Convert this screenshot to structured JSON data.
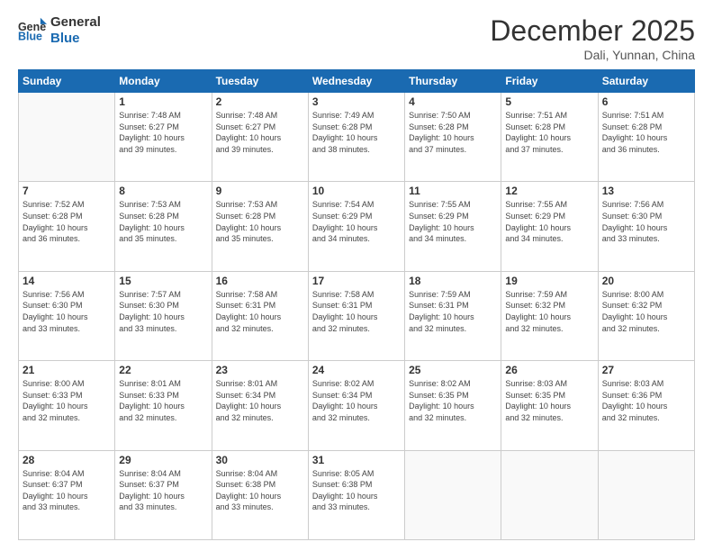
{
  "header": {
    "logo_line1": "General",
    "logo_line2": "Blue",
    "month_title": "December 2025",
    "location": "Dali, Yunnan, China"
  },
  "weekdays": [
    "Sunday",
    "Monday",
    "Tuesday",
    "Wednesday",
    "Thursday",
    "Friday",
    "Saturday"
  ],
  "weeks": [
    [
      {
        "day": "",
        "info": ""
      },
      {
        "day": "1",
        "info": "Sunrise: 7:48 AM\nSunset: 6:27 PM\nDaylight: 10 hours\nand 39 minutes."
      },
      {
        "day": "2",
        "info": "Sunrise: 7:48 AM\nSunset: 6:27 PM\nDaylight: 10 hours\nand 39 minutes."
      },
      {
        "day": "3",
        "info": "Sunrise: 7:49 AM\nSunset: 6:28 PM\nDaylight: 10 hours\nand 38 minutes."
      },
      {
        "day": "4",
        "info": "Sunrise: 7:50 AM\nSunset: 6:28 PM\nDaylight: 10 hours\nand 37 minutes."
      },
      {
        "day": "5",
        "info": "Sunrise: 7:51 AM\nSunset: 6:28 PM\nDaylight: 10 hours\nand 37 minutes."
      },
      {
        "day": "6",
        "info": "Sunrise: 7:51 AM\nSunset: 6:28 PM\nDaylight: 10 hours\nand 36 minutes."
      }
    ],
    [
      {
        "day": "7",
        "info": "Sunrise: 7:52 AM\nSunset: 6:28 PM\nDaylight: 10 hours\nand 36 minutes."
      },
      {
        "day": "8",
        "info": "Sunrise: 7:53 AM\nSunset: 6:28 PM\nDaylight: 10 hours\nand 35 minutes."
      },
      {
        "day": "9",
        "info": "Sunrise: 7:53 AM\nSunset: 6:28 PM\nDaylight: 10 hours\nand 35 minutes."
      },
      {
        "day": "10",
        "info": "Sunrise: 7:54 AM\nSunset: 6:29 PM\nDaylight: 10 hours\nand 34 minutes."
      },
      {
        "day": "11",
        "info": "Sunrise: 7:55 AM\nSunset: 6:29 PM\nDaylight: 10 hours\nand 34 minutes."
      },
      {
        "day": "12",
        "info": "Sunrise: 7:55 AM\nSunset: 6:29 PM\nDaylight: 10 hours\nand 34 minutes."
      },
      {
        "day": "13",
        "info": "Sunrise: 7:56 AM\nSunset: 6:30 PM\nDaylight: 10 hours\nand 33 minutes."
      }
    ],
    [
      {
        "day": "14",
        "info": "Sunrise: 7:56 AM\nSunset: 6:30 PM\nDaylight: 10 hours\nand 33 minutes."
      },
      {
        "day": "15",
        "info": "Sunrise: 7:57 AM\nSunset: 6:30 PM\nDaylight: 10 hours\nand 33 minutes."
      },
      {
        "day": "16",
        "info": "Sunrise: 7:58 AM\nSunset: 6:31 PM\nDaylight: 10 hours\nand 32 minutes."
      },
      {
        "day": "17",
        "info": "Sunrise: 7:58 AM\nSunset: 6:31 PM\nDaylight: 10 hours\nand 32 minutes."
      },
      {
        "day": "18",
        "info": "Sunrise: 7:59 AM\nSunset: 6:31 PM\nDaylight: 10 hours\nand 32 minutes."
      },
      {
        "day": "19",
        "info": "Sunrise: 7:59 AM\nSunset: 6:32 PM\nDaylight: 10 hours\nand 32 minutes."
      },
      {
        "day": "20",
        "info": "Sunrise: 8:00 AM\nSunset: 6:32 PM\nDaylight: 10 hours\nand 32 minutes."
      }
    ],
    [
      {
        "day": "21",
        "info": "Sunrise: 8:00 AM\nSunset: 6:33 PM\nDaylight: 10 hours\nand 32 minutes."
      },
      {
        "day": "22",
        "info": "Sunrise: 8:01 AM\nSunset: 6:33 PM\nDaylight: 10 hours\nand 32 minutes."
      },
      {
        "day": "23",
        "info": "Sunrise: 8:01 AM\nSunset: 6:34 PM\nDaylight: 10 hours\nand 32 minutes."
      },
      {
        "day": "24",
        "info": "Sunrise: 8:02 AM\nSunset: 6:34 PM\nDaylight: 10 hours\nand 32 minutes."
      },
      {
        "day": "25",
        "info": "Sunrise: 8:02 AM\nSunset: 6:35 PM\nDaylight: 10 hours\nand 32 minutes."
      },
      {
        "day": "26",
        "info": "Sunrise: 8:03 AM\nSunset: 6:35 PM\nDaylight: 10 hours\nand 32 minutes."
      },
      {
        "day": "27",
        "info": "Sunrise: 8:03 AM\nSunset: 6:36 PM\nDaylight: 10 hours\nand 32 minutes."
      }
    ],
    [
      {
        "day": "28",
        "info": "Sunrise: 8:04 AM\nSunset: 6:37 PM\nDaylight: 10 hours\nand 33 minutes."
      },
      {
        "day": "29",
        "info": "Sunrise: 8:04 AM\nSunset: 6:37 PM\nDaylight: 10 hours\nand 33 minutes."
      },
      {
        "day": "30",
        "info": "Sunrise: 8:04 AM\nSunset: 6:38 PM\nDaylight: 10 hours\nand 33 minutes."
      },
      {
        "day": "31",
        "info": "Sunrise: 8:05 AM\nSunset: 6:38 PM\nDaylight: 10 hours\nand 33 minutes."
      },
      {
        "day": "",
        "info": ""
      },
      {
        "day": "",
        "info": ""
      },
      {
        "day": "",
        "info": ""
      }
    ]
  ]
}
